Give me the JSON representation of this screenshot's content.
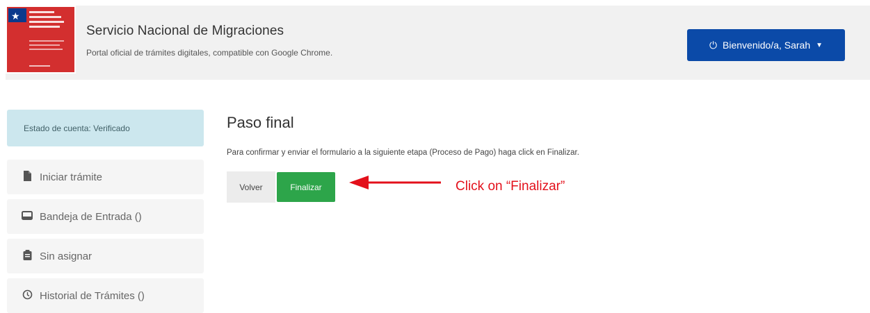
{
  "header": {
    "title": "Servicio Nacional de Migraciones",
    "subtitle": "Portal oficial de trámites digitales, compatible con Google Chrome.",
    "user_menu_label": "Bienvenido/a, Sarah",
    "logo_text": "Servicio Nacional de Migraciones"
  },
  "sidebar": {
    "status": "Estado de cuenta: Verificado",
    "items": [
      {
        "label": "Iniciar trámite",
        "icon": "file-icon"
      },
      {
        "label": "Bandeja de Entrada ()",
        "icon": "inbox-icon"
      },
      {
        "label": "Sin asignar",
        "icon": "clipboard-icon"
      },
      {
        "label": "Historial de Trámites ()",
        "icon": "history-icon"
      }
    ]
  },
  "main": {
    "title": "Paso final",
    "instruction": "Para confirmar y enviar el formulario a la siguiente etapa (Proceso de Pago) haga click en Finalizar.",
    "back_label": "Volver",
    "finish_label": "Finalizar"
  },
  "annotation": {
    "text": "Click on “Finalizar”",
    "color": "#e3101b"
  },
  "colors": {
    "primary": "#0b4aa8",
    "success": "#2da54a",
    "status_bg": "#cce7ee",
    "logo_red": "#d32f2f",
    "logo_blue": "#0b3a8c"
  }
}
